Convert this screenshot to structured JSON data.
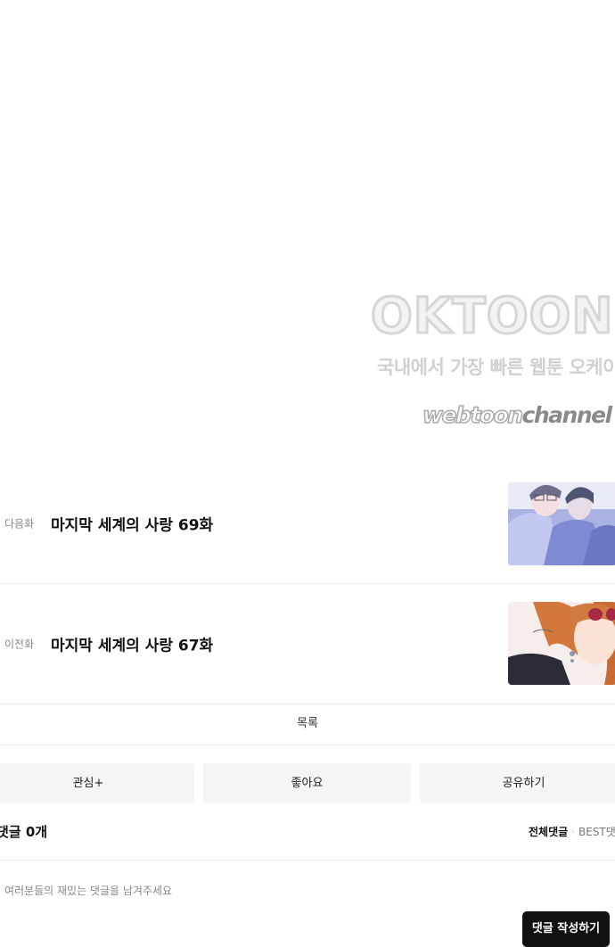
{
  "banner": {
    "brand": "OKTOON",
    "tagline": "국내에서 가장 빠른 웹툰 오케이툰",
    "logo_part_a": "webtoon",
    "logo_part_b": "channel"
  },
  "next_episode": {
    "tag": "다음화",
    "title": "마지막 세계의 사랑 69화"
  },
  "prev_episode": {
    "tag": "이전화",
    "title": "마지막 세계의 사랑 67화"
  },
  "list_label": "목록",
  "actions": {
    "interest": "관심+",
    "like": "좋아요",
    "share": "공유하기"
  },
  "comments": {
    "count_label": "댓글 0개",
    "tab_all": "전체댓글",
    "tab_best": "BEST댓글",
    "placeholder": "여러분들의 재밌는 댓글을 남겨주세요",
    "write_label": "댓글 작성하기"
  },
  "colors": {
    "accent": "#111111",
    "button_bg": "#f5f5f5",
    "divider": "#ebebeb"
  }
}
